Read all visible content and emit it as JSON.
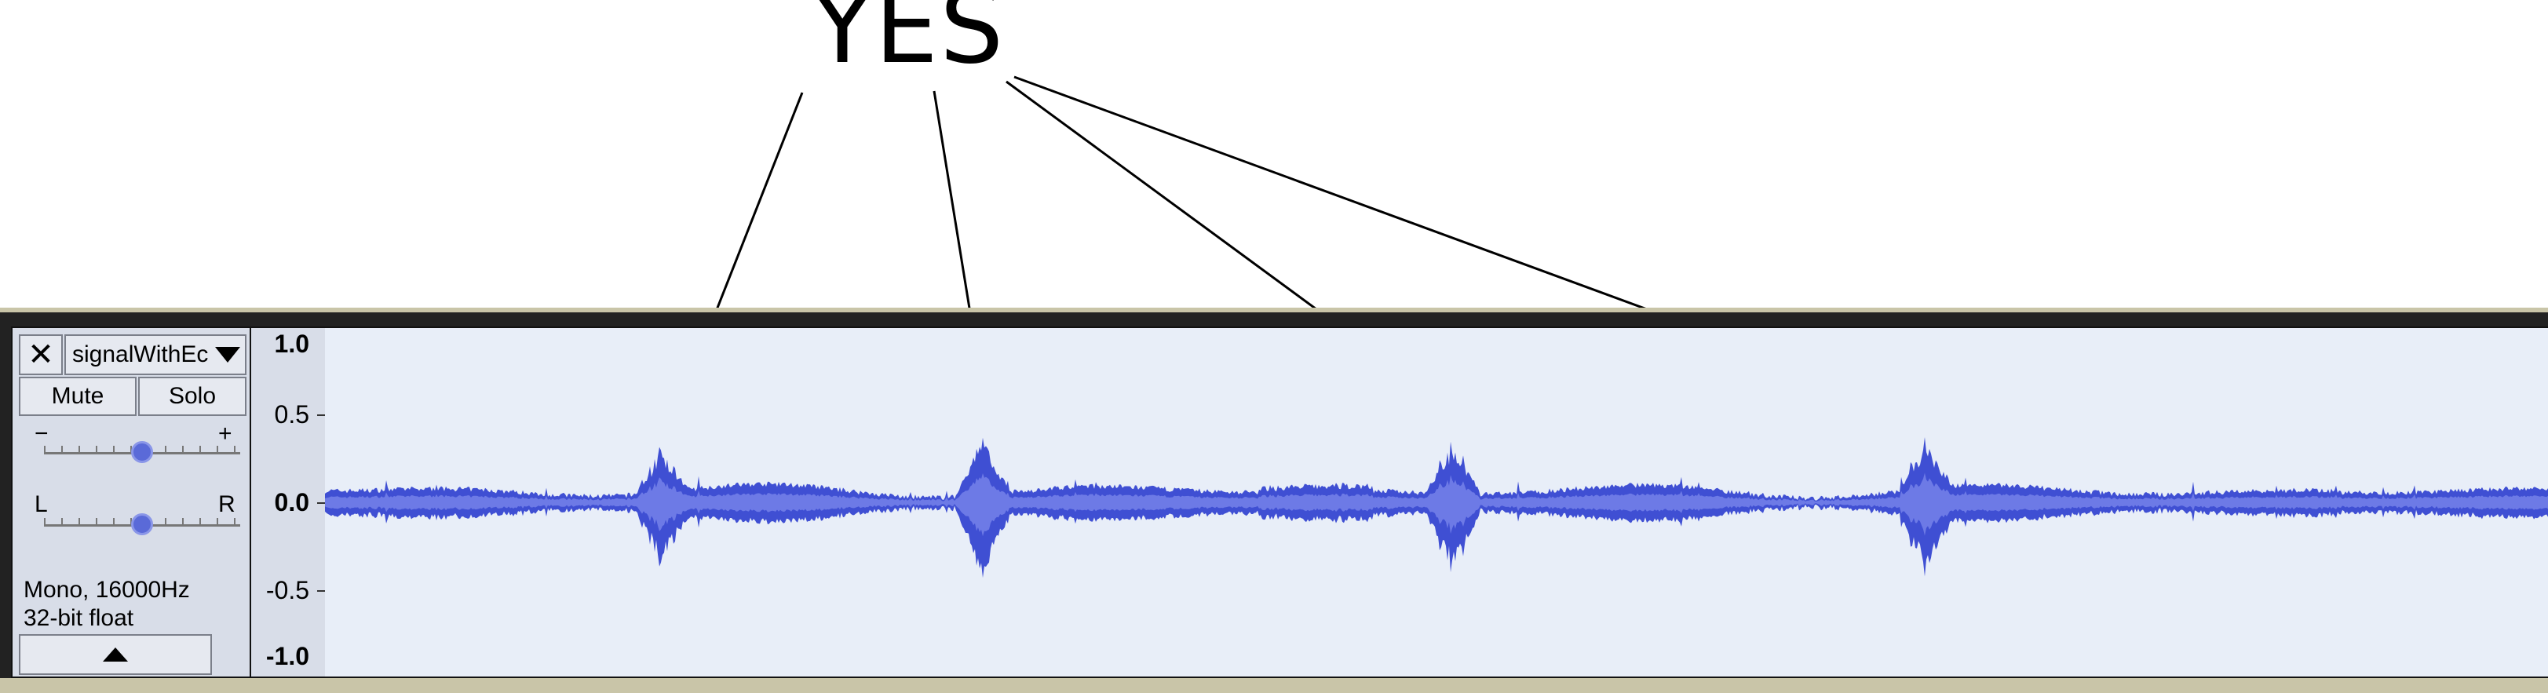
{
  "annotation": {
    "label": "YES"
  },
  "track": {
    "name": "signalWithEc",
    "close_glyph": "✕",
    "mute_label": "Mute",
    "solo_label": "Solo",
    "gain_min_label": "−",
    "gain_max_label": "+",
    "pan_left_label": "L",
    "pan_right_label": "R",
    "format_line1": "Mono, 16000Hz",
    "format_line2": "32-bit float",
    "gain_level": 0.5,
    "pan_level": 0.5
  },
  "vertical_ruler": {
    "labels": [
      "1.0",
      "0.5",
      "0.0",
      "-0.5",
      "-1.0"
    ]
  },
  "waveform": {
    "color": "#3f4fd3",
    "inner_color": "#6d7ae6",
    "background": "#e8eef8",
    "peak_positions": [
      0.151,
      0.295,
      0.506,
      0.718
    ],
    "peak_amplitudes": [
      0.32,
      0.44,
      0.42,
      0.36
    ]
  },
  "colors": {
    "panel": "#d8dde8",
    "frame_accent": "#c9c5a8"
  }
}
